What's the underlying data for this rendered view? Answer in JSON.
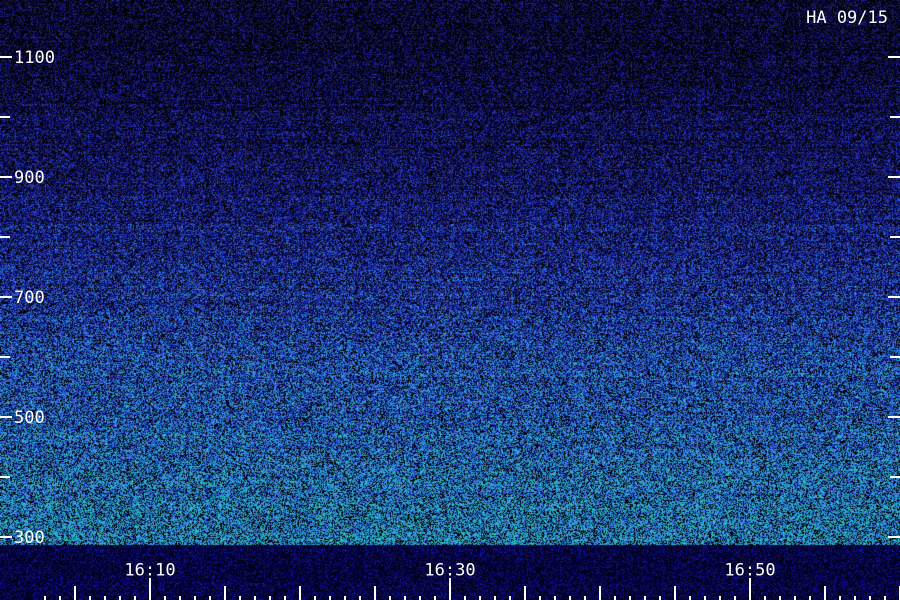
{
  "chart_data": {
    "type": "heatmap",
    "title": "HA 09/15",
    "xlabel": "",
    "ylabel": "",
    "x_range": [
      "16:03",
      "17:02"
    ],
    "ylim": [
      300,
      1130
    ],
    "y_ticks": [
      300,
      500,
      700,
      900,
      1100
    ],
    "y_minor_ticks": [
      400,
      600,
      800,
      1000
    ],
    "x_ticks": [
      "16:10",
      "16:30",
      "16:50"
    ],
    "x_minor_ticks": [
      "16:05",
      "16:15",
      "16:20",
      "16:25",
      "16:35",
      "16:40",
      "16:45",
      "16:55",
      "17:00"
    ],
    "x_micro_step_minutes": 1,
    "colormap": [
      "#000000",
      "#12125c",
      "#2424b4",
      "#2a64d6",
      "#30b0d8",
      "#28d2a0",
      "#40f080"
    ],
    "intensity_profile": [
      {
        "frequency": 300,
        "level": 0.62
      },
      {
        "frequency": 400,
        "level": 0.58
      },
      {
        "frequency": 500,
        "level": 0.52
      },
      {
        "frequency": 600,
        "level": 0.48
      },
      {
        "frequency": 700,
        "level": 0.4
      },
      {
        "frequency": 800,
        "level": 0.32
      },
      {
        "frequency": 900,
        "level": 0.24
      },
      {
        "frequency": 1000,
        "level": 0.18
      },
      {
        "frequency": 1100,
        "level": 0.13
      },
      {
        "frequency": 1130,
        "level": 0.12
      }
    ],
    "grid": false
  }
}
